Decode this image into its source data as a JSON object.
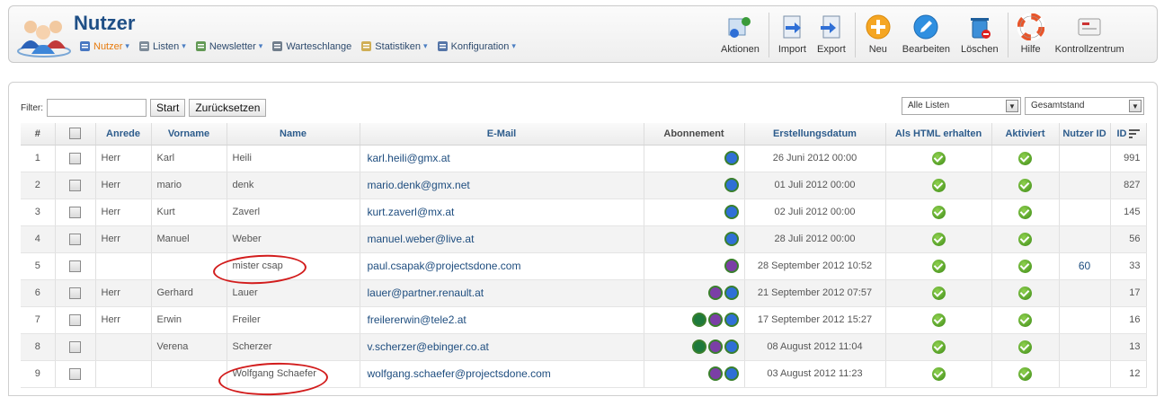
{
  "header": {
    "title": "Nutzer",
    "menu": [
      {
        "label": "Nutzer",
        "icon": "users-icon",
        "caret": true,
        "active": true
      },
      {
        "label": "Listen",
        "icon": "list-icon",
        "caret": true
      },
      {
        "label": "Newsletter",
        "icon": "newsletter-icon",
        "caret": true
      },
      {
        "label": "Warteschlange",
        "icon": "queue-icon",
        "caret": false
      },
      {
        "label": "Statistiken",
        "icon": "statistics-icon",
        "caret": true
      },
      {
        "label": "Konfiguration",
        "icon": "configuration-icon",
        "caret": true
      }
    ],
    "caret_glyph": "▾",
    "toolbar": {
      "actions": "Aktionen",
      "import": "Import",
      "export": "Export",
      "new": "Neu",
      "edit": "Bearbeiten",
      "delete": "Löschen",
      "help": "Hilfe",
      "control_center": "Kontrollzentrum"
    }
  },
  "filter": {
    "label": "Filter:",
    "value": "",
    "start_button": "Start",
    "reset_button": "Zurücksetzen",
    "list_select": "Alle Listen",
    "status_select": "Gesamtstand"
  },
  "table": {
    "columns": {
      "num": "#",
      "salutation": "Anrede",
      "firstname": "Vorname",
      "name": "Name",
      "email": "E-Mail",
      "subscription": "Abonnement",
      "created": "Erstellungsdatum",
      "html": "Als HTML erhalten",
      "active": "Aktiviert",
      "user_id": "Nutzer ID",
      "id": "ID"
    },
    "rows": [
      {
        "num": "1",
        "salutation": "Herr",
        "firstname": "Karl",
        "name": "Heili",
        "email": "karl.heili@gmx.at",
        "subs": [
          "#2f6fd6"
        ],
        "created": "26 Juni 2012 00:00",
        "html": true,
        "active": true,
        "user_id": "",
        "id": "991"
      },
      {
        "num": "2",
        "salutation": "Herr",
        "firstname": "mario",
        "name": "denk",
        "email": "mario.denk@gmx.net",
        "subs": [
          "#2f6fd6"
        ],
        "created": "01 Juli 2012 00:00",
        "html": true,
        "active": true,
        "user_id": "",
        "id": "827"
      },
      {
        "num": "3",
        "salutation": "Herr",
        "firstname": "Kurt",
        "name": "Zaverl",
        "email": "kurt.zaverl@mx.at",
        "subs": [
          "#2f6fd6"
        ],
        "created": "02 Juli 2012 00:00",
        "html": true,
        "active": true,
        "user_id": "",
        "id": "145"
      },
      {
        "num": "4",
        "salutation": "Herr",
        "firstname": "Manuel",
        "name": "Weber",
        "email": "manuel.weber@live.at",
        "subs": [
          "#2f6fd6"
        ],
        "created": "28 Juli 2012 00:00",
        "html": true,
        "active": true,
        "user_id": "",
        "id": "56"
      },
      {
        "num": "5",
        "salutation": "",
        "firstname": "",
        "name": "mister csap",
        "email": "paul.csapak@projectsdone.com",
        "subs": [
          "#7b3fa6"
        ],
        "created": "28 September 2012 10:52",
        "html": true,
        "active": true,
        "user_id": "60",
        "id": "33"
      },
      {
        "num": "6",
        "salutation": "Herr",
        "firstname": "Gerhard",
        "name": "Lauer",
        "email": "lauer@partner.renault.at",
        "subs": [
          "#7b3fa6",
          "#2f6fd6"
        ],
        "created": "21 September 2012 07:57",
        "html": true,
        "active": true,
        "user_id": "",
        "id": "17"
      },
      {
        "num": "7",
        "salutation": "Herr",
        "firstname": "Erwin",
        "name": "Freiler",
        "email": "freilererwin@tele2.at",
        "subs": [
          "#1e7a3c",
          "#7b3fa6",
          "#2f6fd6"
        ],
        "created": "17 September 2012 15:27",
        "html": true,
        "active": true,
        "user_id": "",
        "id": "16"
      },
      {
        "num": "8",
        "salutation": "",
        "firstname": "Verena",
        "name": "Scherzer",
        "email": "v.scherzer@ebinger.co.at",
        "subs": [
          "#1e7a3c",
          "#7b3fa6",
          "#2f6fd6"
        ],
        "created": "08 August 2012 11:04",
        "html": true,
        "active": true,
        "user_id": "",
        "id": "13"
      },
      {
        "num": "9",
        "salutation": "",
        "firstname": "",
        "name": "Wolfgang Schaefer",
        "email": "wolfgang.schaefer@projectsdone.com",
        "subs": [
          "#7b3fa6",
          "#2f6fd6"
        ],
        "created": "03 August 2012 11:23",
        "html": true,
        "active": true,
        "user_id": "",
        "id": "12"
      }
    ]
  },
  "colors": {
    "annotation_circle": "#d21c1c",
    "link": "#1e4d7f",
    "header_title": "#1f4f86"
  }
}
